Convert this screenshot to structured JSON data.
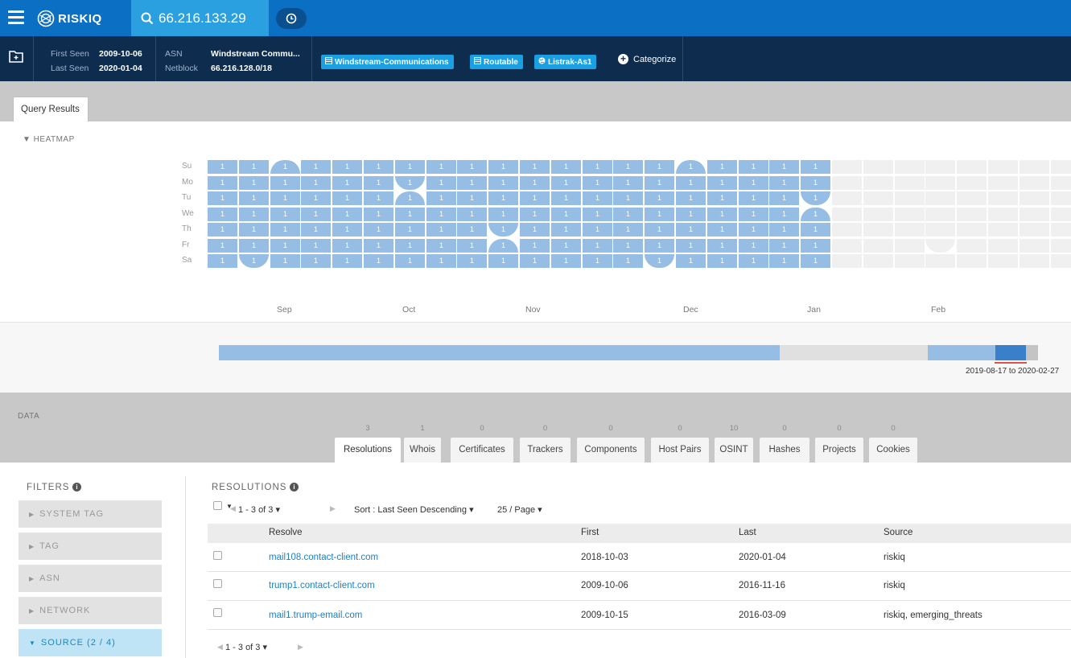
{
  "brand": "RISKIQ",
  "search": {
    "query": "66.216.133.29"
  },
  "info": {
    "first_seen_label": "First Seen",
    "first_seen": "2009-10-06",
    "last_seen_label": "Last Seen",
    "last_seen": "2020-01-04",
    "asn_label": "ASN",
    "asn": "Windstream Commu...",
    "netblock_label": "Netblock",
    "netblock": "66.216.128.0/18"
  },
  "tags": [
    {
      "label": "Windstream-Communications",
      "icon": "building-icon"
    },
    {
      "label": "Routable",
      "icon": "building-icon"
    },
    {
      "label": "Listrak-As1",
      "icon": "globe-icon"
    }
  ],
  "categorize_label": "Categorize",
  "query_results_tab": "Query Results",
  "heatmap": {
    "toggle_label": "▼ HEATMAP",
    "days": [
      "Su",
      "Mo",
      "Tu",
      "We",
      "Th",
      "Fr",
      "Sa"
    ],
    "months": [
      "Sep",
      "Oct",
      "Nov",
      "Dec",
      "Jan",
      "Feb"
    ],
    "cell_value": "1",
    "accent_color": "#96bde4"
  },
  "timeline": {
    "range_label": "2019-08-17 to 2020-02-27"
  },
  "data_label": "DATA",
  "data_tabs": [
    {
      "label": "Resolutions",
      "count": "3"
    },
    {
      "label": "Whois",
      "count": "1"
    },
    {
      "label": "Certificates",
      "count": "0"
    },
    {
      "label": "Trackers",
      "count": "0"
    },
    {
      "label": "Components",
      "count": "0"
    },
    {
      "label": "Host Pairs",
      "count": "0"
    },
    {
      "label": "OSINT",
      "count": "10"
    },
    {
      "label": "Hashes",
      "count": "0"
    },
    {
      "label": "Projects",
      "count": "0"
    },
    {
      "label": "Cookies",
      "count": "0"
    }
  ],
  "filters": {
    "title": "FILTERS",
    "items": [
      {
        "label": "SYSTEM TAG"
      },
      {
        "label": "TAG"
      },
      {
        "label": "ASN"
      },
      {
        "label": "NETWORK"
      },
      {
        "label": "SOURCE (2 / 4)"
      }
    ]
  },
  "resolutions": {
    "title": "RESOLUTIONS",
    "pager": "1 - 3 of 3 ▾",
    "sort": "Sort : Last Seen Descending ▾",
    "per_page": "25 / Page ▾",
    "columns": [
      "Resolve",
      "First",
      "Last",
      "Source"
    ],
    "rows": [
      {
        "resolve": "mail108.contact-client.com",
        "first": "2018-10-03",
        "last": "2020-01-04",
        "source": "riskiq"
      },
      {
        "resolve": "trump1.contact-client.com",
        "first": "2009-10-06",
        "last": "2016-11-16",
        "source": "riskiq"
      },
      {
        "resolve": "mail1.trump-email.com",
        "first": "2009-10-15",
        "last": "2016-03-09",
        "source": "riskiq, emerging_threats"
      }
    ],
    "footer_pager": "1 - 3 of 3 ▾"
  }
}
